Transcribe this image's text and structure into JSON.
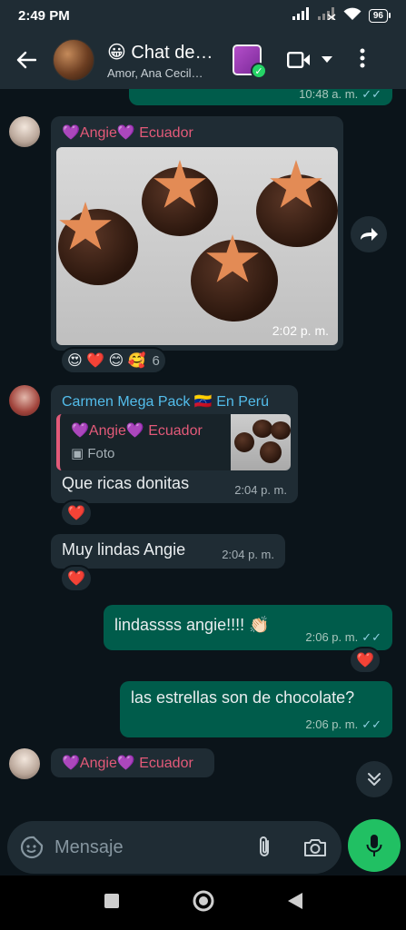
{
  "status_bar": {
    "time": "2:49 PM",
    "battery": "96"
  },
  "header": {
    "title": "😀 Chat de…",
    "subtitle": "Amor, Ana Cecil…"
  },
  "messages": {
    "prev_out_time": "10:48 a. m.",
    "angie_photo": {
      "sender": "💜Angie💜 Ecuador",
      "time": "2:02 p. m.",
      "reactions": "😍 ❤️ 😊 🥰",
      "reaction_count": "6"
    },
    "carmen_reply": {
      "sender": "Carmen Mega Pack 🇻🇪 En Perú",
      "quote_sender": "💜Angie💜 Ecuador",
      "quote_type": "Foto",
      "text": "Que ricas donitas",
      "time": "2:04 p. m.",
      "reaction": "❤️"
    },
    "carmen_second": {
      "text": "Muy lindas Angie",
      "time": "2:04 p. m.",
      "reaction": "❤️"
    },
    "out_1": {
      "text": "lindassss angie!!!! 👏🏻",
      "time": "2:06 p. m.",
      "reaction": "❤️"
    },
    "out_2": {
      "text": "las estrellas son de chocolate?",
      "time": "2:06 p. m."
    },
    "angie_last": {
      "sender": "💜Angie💜 Ecuador"
    }
  },
  "input": {
    "placeholder": "Mensaje"
  },
  "colors": {
    "outgoing": "#005c4b",
    "incoming": "#1f2c34",
    "accent": "#21c063",
    "angie_name": "#e35a79",
    "carmen_name": "#53bdeb"
  }
}
